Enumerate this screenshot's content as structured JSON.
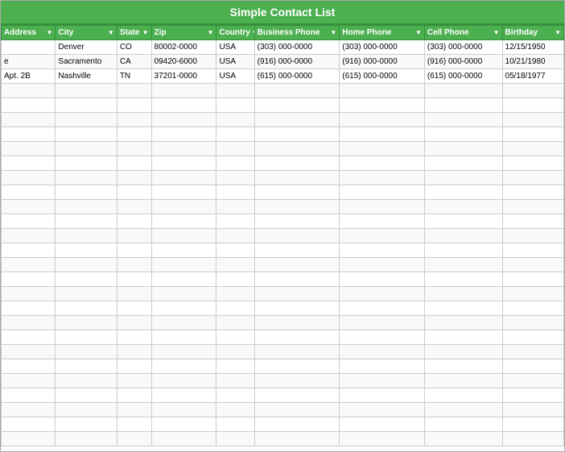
{
  "title": "Simple Contact List",
  "columns": [
    {
      "key": "address",
      "label": "Address"
    },
    {
      "key": "city",
      "label": "City"
    },
    {
      "key": "state",
      "label": "State"
    },
    {
      "key": "zip",
      "label": "Zip"
    },
    {
      "key": "country",
      "label": "Country"
    },
    {
      "key": "bphone",
      "label": "Business Phone"
    },
    {
      "key": "hphone",
      "label": "Home Phone"
    },
    {
      "key": "cphone",
      "label": "Cell Phone"
    },
    {
      "key": "birthday",
      "label": "Birthday"
    }
  ],
  "rows": [
    {
      "address": "",
      "city": "Denver",
      "state": "CO",
      "zip": "80002-0000",
      "country": "USA",
      "bphone": "(303) 000-0000",
      "hphone": "(303) 000-0000",
      "cphone": "(303) 000-0000",
      "birthday": "12/15/1950"
    },
    {
      "address": "e",
      "city": "Sacramento",
      "state": "CA",
      "zip": "09420-6000",
      "country": "USA",
      "bphone": "(916) 000-0000",
      "hphone": "(916) 000-0000",
      "cphone": "(916) 000-0000",
      "birthday": "10/21/1980"
    },
    {
      "address": "Apt. 2B",
      "city": "Nashville",
      "state": "TN",
      "zip": "37201-0000",
      "country": "USA",
      "bphone": "(615) 000-0000",
      "hphone": "(615) 000-0000",
      "cphone": "(615) 000-0000",
      "birthday": "05/18/1977"
    },
    {
      "address": "",
      "city": "",
      "state": "",
      "zip": "",
      "country": "",
      "bphone": "",
      "hphone": "",
      "cphone": "",
      "birthday": ""
    },
    {
      "address": "",
      "city": "",
      "state": "",
      "zip": "",
      "country": "",
      "bphone": "",
      "hphone": "",
      "cphone": "",
      "birthday": ""
    },
    {
      "address": "",
      "city": "",
      "state": "",
      "zip": "",
      "country": "",
      "bphone": "",
      "hphone": "",
      "cphone": "",
      "birthday": ""
    },
    {
      "address": "",
      "city": "",
      "state": "",
      "zip": "",
      "country": "",
      "bphone": "",
      "hphone": "",
      "cphone": "",
      "birthday": ""
    },
    {
      "address": "",
      "city": "",
      "state": "",
      "zip": "",
      "country": "",
      "bphone": "",
      "hphone": "",
      "cphone": "",
      "birthday": ""
    },
    {
      "address": "",
      "city": "",
      "state": "",
      "zip": "",
      "country": "",
      "bphone": "",
      "hphone": "",
      "cphone": "",
      "birthday": ""
    },
    {
      "address": "",
      "city": "",
      "state": "",
      "zip": "",
      "country": "",
      "bphone": "",
      "hphone": "",
      "cphone": "",
      "birthday": ""
    },
    {
      "address": "",
      "city": "",
      "state": "",
      "zip": "",
      "country": "",
      "bphone": "",
      "hphone": "",
      "cphone": "",
      "birthday": ""
    },
    {
      "address": "",
      "city": "",
      "state": "",
      "zip": "",
      "country": "",
      "bphone": "",
      "hphone": "",
      "cphone": "",
      "birthday": ""
    },
    {
      "address": "",
      "city": "",
      "state": "",
      "zip": "",
      "country": "",
      "bphone": "",
      "hphone": "",
      "cphone": "",
      "birthday": ""
    },
    {
      "address": "",
      "city": "",
      "state": "",
      "zip": "",
      "country": "",
      "bphone": "",
      "hphone": "",
      "cphone": "",
      "birthday": ""
    },
    {
      "address": "",
      "city": "",
      "state": "",
      "zip": "",
      "country": "",
      "bphone": "",
      "hphone": "",
      "cphone": "",
      "birthday": ""
    },
    {
      "address": "",
      "city": "",
      "state": "",
      "zip": "",
      "country": "",
      "bphone": "",
      "hphone": "",
      "cphone": "",
      "birthday": ""
    },
    {
      "address": "",
      "city": "",
      "state": "",
      "zip": "",
      "country": "",
      "bphone": "",
      "hphone": "",
      "cphone": "",
      "birthday": ""
    },
    {
      "address": "",
      "city": "",
      "state": "",
      "zip": "",
      "country": "",
      "bphone": "",
      "hphone": "",
      "cphone": "",
      "birthday": ""
    },
    {
      "address": "",
      "city": "",
      "state": "",
      "zip": "",
      "country": "",
      "bphone": "",
      "hphone": "",
      "cphone": "",
      "birthday": ""
    },
    {
      "address": "",
      "city": "",
      "state": "",
      "zip": "",
      "country": "",
      "bphone": "",
      "hphone": "",
      "cphone": "",
      "birthday": ""
    },
    {
      "address": "",
      "city": "",
      "state": "",
      "zip": "",
      "country": "",
      "bphone": "",
      "hphone": "",
      "cphone": "",
      "birthday": ""
    },
    {
      "address": "",
      "city": "",
      "state": "",
      "zip": "",
      "country": "",
      "bphone": "",
      "hphone": "",
      "cphone": "",
      "birthday": ""
    },
    {
      "address": "",
      "city": "",
      "state": "",
      "zip": "",
      "country": "",
      "bphone": "",
      "hphone": "",
      "cphone": "",
      "birthday": ""
    },
    {
      "address": "",
      "city": "",
      "state": "",
      "zip": "",
      "country": "",
      "bphone": "",
      "hphone": "",
      "cphone": "",
      "birthday": ""
    },
    {
      "address": "",
      "city": "",
      "state": "",
      "zip": "",
      "country": "",
      "bphone": "",
      "hphone": "",
      "cphone": "",
      "birthday": ""
    },
    {
      "address": "",
      "city": "",
      "state": "",
      "zip": "",
      "country": "",
      "bphone": "",
      "hphone": "",
      "cphone": "",
      "birthday": ""
    },
    {
      "address": "",
      "city": "",
      "state": "",
      "zip": "",
      "country": "",
      "bphone": "",
      "hphone": "",
      "cphone": "",
      "birthday": ""
    },
    {
      "address": "",
      "city": "",
      "state": "",
      "zip": "",
      "country": "",
      "bphone": "",
      "hphone": "",
      "cphone": "",
      "birthday": ""
    }
  ]
}
